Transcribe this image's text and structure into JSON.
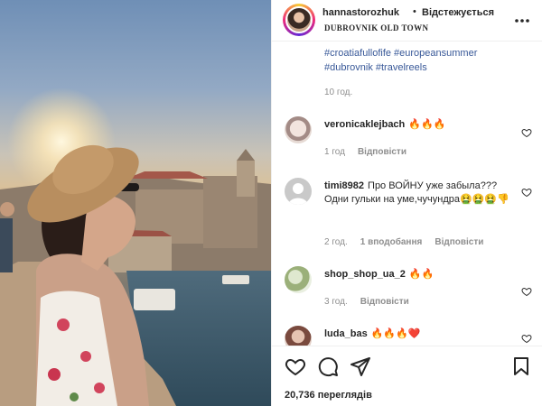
{
  "header": {
    "username": "hannastorozhuk",
    "separator": "•",
    "follow_status": "Відстежується",
    "location": "DUBROVNIK OLD TOWN",
    "more_icon": "more-horizontal-icon"
  },
  "caption": {
    "hashtags_line1": "#croatiafullofife #europeansummer",
    "hashtags_line2": "#dubrovnik #travelreels",
    "time": "10 год."
  },
  "comments": [
    {
      "username": "veronicaklejbach",
      "text": "🔥🔥🔥",
      "time": "1 год",
      "reply": "Відповісти",
      "likes": ""
    },
    {
      "username": "timi8982",
      "text": "Про ВОЙНУ уже забыла???Одни гульки на уме,чучундра🤮🤮🤮👎",
      "time": "2 год.",
      "likes": "1 вподобання",
      "reply": "Відповісти"
    },
    {
      "username": "shop_shop_ua_2",
      "text": "🔥🔥",
      "time": "3 год.",
      "reply": "Відповісти",
      "likes": ""
    },
    {
      "username": "luda_bas",
      "text": "🔥🔥🔥❤️",
      "time": "",
      "reply": "",
      "likes": ""
    }
  ],
  "actions": {
    "like_icon": "heart-icon",
    "comment_icon": "comment-icon",
    "share_icon": "share-icon",
    "save_icon": "bookmark-icon"
  },
  "views": {
    "count": "20,736",
    "label": "переглядів"
  }
}
